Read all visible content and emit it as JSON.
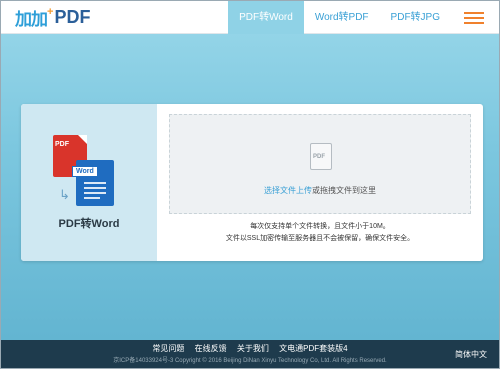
{
  "header": {
    "logo_mark": "加加",
    "logo_plus": "+",
    "logo_text": "PDF",
    "nav": [
      {
        "label": "PDF转Word",
        "active": true
      },
      {
        "label": "Word转PDF",
        "active": false
      },
      {
        "label": "PDF转JPG",
        "active": false
      }
    ],
    "menu_icon": "hamburger-menu-icon",
    "accent_color": "#f0812d"
  },
  "converter": {
    "title": "PDF转Word",
    "pdf_tag": "PDF",
    "word_tag": "Word",
    "drop_doc_tag": "PDF",
    "select_link": "选择文件上传",
    "drop_hint": "或拖拽文件到这里",
    "note_line1": "每次仅支持单个文件转换，且文件小于10M。",
    "note_line2": "文件以SSL加密传输至服务器且不会被保留，确保文件安全。"
  },
  "footer": {
    "links": [
      "常见问题",
      "在线反馈",
      "关于我们",
      "文电通PDF套装版4"
    ],
    "copyright": "京ICP备14033924号-3 Copyright © 2016 Beijing DiNan Xinyu Technology Co, Ltd. All Rights Reserved.",
    "language": "简体中文"
  },
  "colors": {
    "link_blue": "#3aa0d5",
    "pdf_red": "#d9342b",
    "word_blue": "#1f6cc0",
    "footer_bg": "#1e3b4d"
  }
}
